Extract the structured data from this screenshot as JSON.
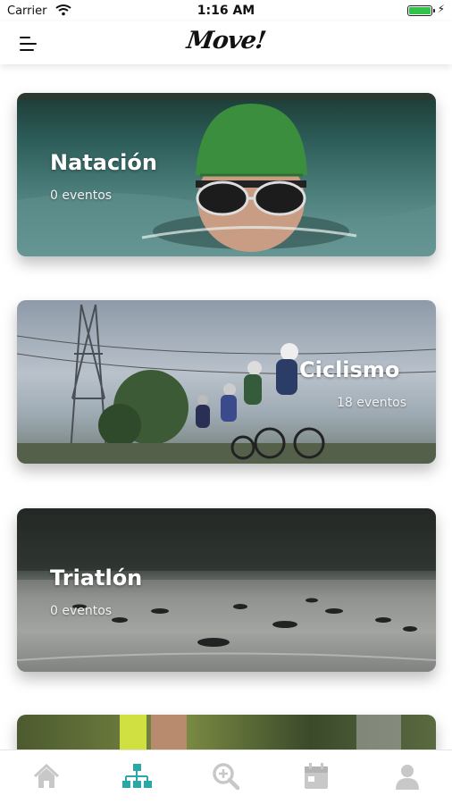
{
  "status_bar": {
    "carrier": "Carrier",
    "time": "1:16 AM"
  },
  "header": {
    "logo_text": "Move!",
    "menu_icon": "hamburger-menu-icon"
  },
  "cards": [
    {
      "title": "Natación",
      "subtitle": "0 eventos"
    },
    {
      "title": "Ciclismo",
      "subtitle": "18 eventos"
    },
    {
      "title": "Triatlón",
      "subtitle": "0 eventos"
    }
  ],
  "tabbar": {
    "items": [
      {
        "icon": "home-icon",
        "active": false
      },
      {
        "icon": "sitemap-icon",
        "active": true
      },
      {
        "icon": "search-zoom-icon",
        "active": false
      },
      {
        "icon": "calendar-icon",
        "active": false
      },
      {
        "icon": "user-icon",
        "active": false
      }
    ],
    "active_color": "#2aa8a8",
    "inactive_color": "#c8c8c8"
  },
  "colors": {
    "battery": "#33c34b"
  }
}
